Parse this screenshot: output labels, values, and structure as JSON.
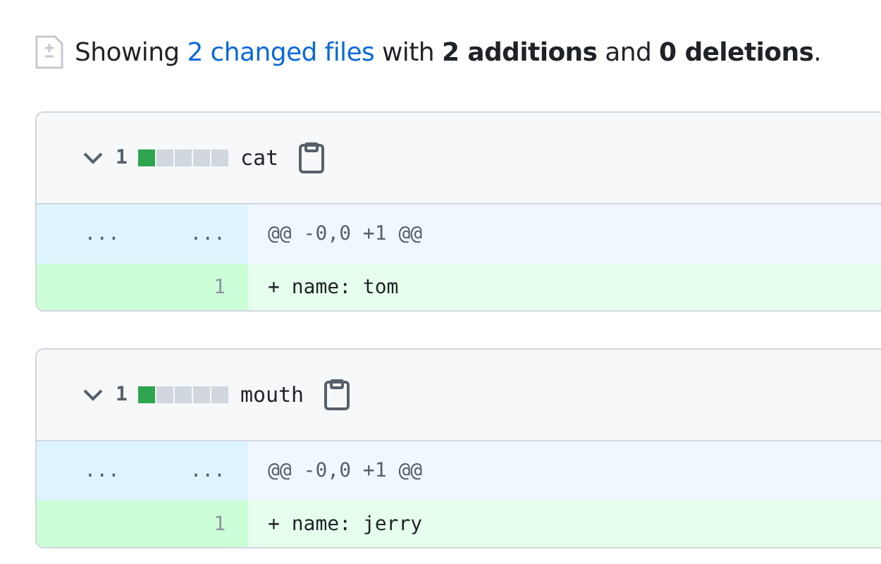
{
  "summary": {
    "prefix": "Showing",
    "link": "2 changed files",
    "rest": "with **2 additions** and **0 deletions**."
  },
  "files": [
    {
      "expanded": true,
      "count": "1",
      "stat": [
        {
          "kind": "added"
        },
        {
          "kind": "neutral"
        },
        {
          "kind": "neutral"
        },
        {
          "kind": "neutral"
        },
        {
          "kind": "neutral"
        }
      ],
      "name": "cat",
      "lines": [
        {
          "kind": "hunk",
          "old": "...",
          "new": "...",
          "text": "@@ -0,0 +1 @@"
        },
        {
          "kind": "addition",
          "new": "1",
          "text": "+ name: tom"
        }
      ]
    },
    {
      "expanded": true,
      "count": "1",
      "stat": [
        {
          "kind": "added"
        },
        {
          "kind": "neutral"
        },
        {
          "kind": "neutral"
        },
        {
          "kind": "neutral"
        },
        {
          "kind": "neutral"
        }
      ],
      "name": "mouth",
      "lines": [
        {
          "kind": "hunk",
          "old": "...",
          "new": "...",
          "text": "@@ -0,0 +1 @@"
        },
        {
          "kind": "addition",
          "new": "1",
          "text": "+ name: jerry"
        }
      ]
    }
  ]
}
